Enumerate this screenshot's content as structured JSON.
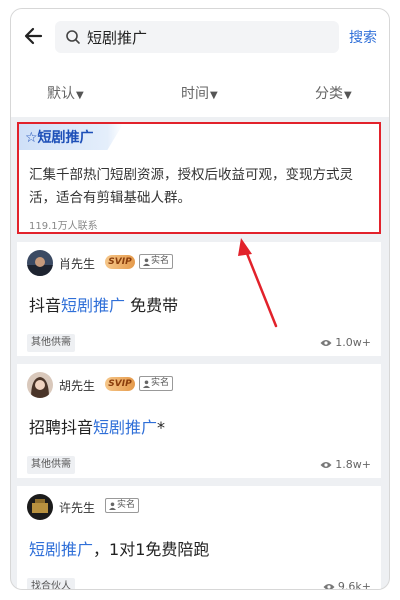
{
  "search": {
    "value": "短剧推广",
    "button_label": "搜索"
  },
  "filters": [
    {
      "label": "默认"
    },
    {
      "label": "时间"
    },
    {
      "label": "分类"
    }
  ],
  "promo": {
    "tag": "☆短剧推广",
    "description": "汇集千部热门短剧资源，授权后收益可观，变现方式灵活，适合有剪辑基础人群。",
    "contacts": "119.1万人联系",
    "highlight_color": "#e2222b"
  },
  "posts": [
    {
      "author": "肖先生",
      "svip": "SVIP",
      "verified": "实名",
      "title_before": "抖音",
      "title_highlight": "短剧推广",
      "title_after": " 免费带",
      "category": "其他供需",
      "views": "1.0w+"
    },
    {
      "author": "胡先生",
      "svip": "SVIP",
      "verified": "实名",
      "title_before": "招聘抖音",
      "title_highlight": "短剧推广",
      "title_after": "*",
      "category": "其他供需",
      "views": "1.8w+"
    },
    {
      "author": "许先生",
      "verified": "实名",
      "title_before": "",
      "title_highlight": "短剧推广",
      "title_after": "，1对1免费陪跑",
      "category": "找合伙人",
      "views": "9.6k+"
    }
  ],
  "colors": {
    "accent": "#2f6fd8",
    "annotation_red": "#e2222b"
  }
}
